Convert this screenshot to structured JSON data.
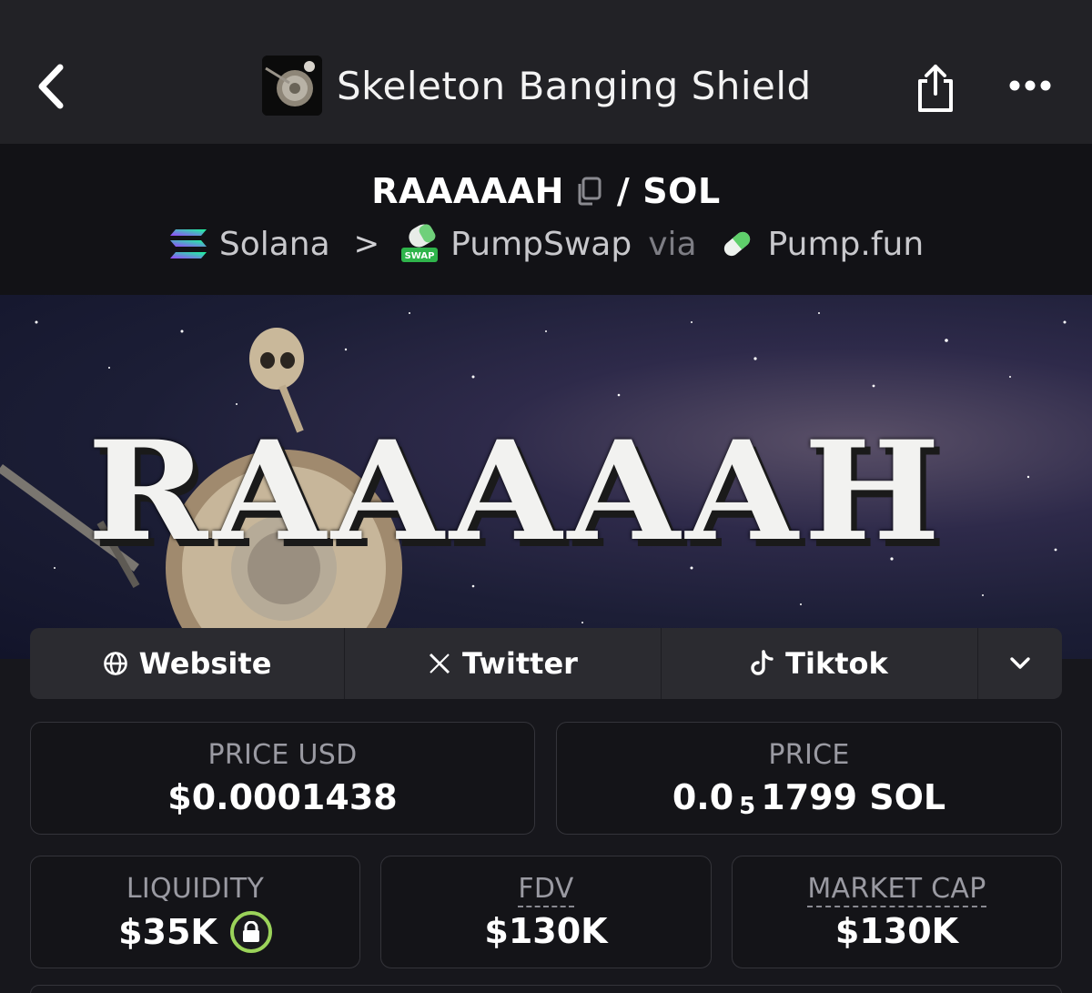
{
  "header": {
    "title": "Skeleton Banging Shield",
    "back_icon": "chevron-left-icon",
    "share_icon": "share-icon",
    "more_icon": "more-horizontal-icon"
  },
  "pair": {
    "base": "RAAAAAH",
    "separator": "/",
    "quote": "SOL",
    "chain": "Solana",
    "chain_sep": ">",
    "dex": "PumpSwap",
    "via": "via",
    "launchpad": "Pump.fun"
  },
  "banner": {
    "text": "RAAAAAH"
  },
  "links": [
    {
      "label": "Website",
      "icon": "globe-icon"
    },
    {
      "label": "Twitter",
      "icon": "x-icon"
    },
    {
      "label": "Tiktok",
      "icon": "tiktok-icon"
    }
  ],
  "stats": {
    "price_usd": {
      "label": "PRICE USD",
      "value": "$0.0001438"
    },
    "price": {
      "label": "PRICE",
      "value_prefix": "0.0",
      "value_sub": "5",
      "value_suffix": "1799 SOL"
    },
    "liquidity": {
      "label": "LIQUIDITY",
      "value": "$35K"
    },
    "fdv": {
      "label": "FDV",
      "value": "$130K"
    },
    "market_cap": {
      "label": "MARKET CAP",
      "value": "$130K"
    }
  },
  "colors": {
    "topbar": "#222226",
    "pairbar": "#121216",
    "page_bg": "#17171c",
    "links_bg": "#2b2b30",
    "lock_ring": "#9bd35a"
  }
}
